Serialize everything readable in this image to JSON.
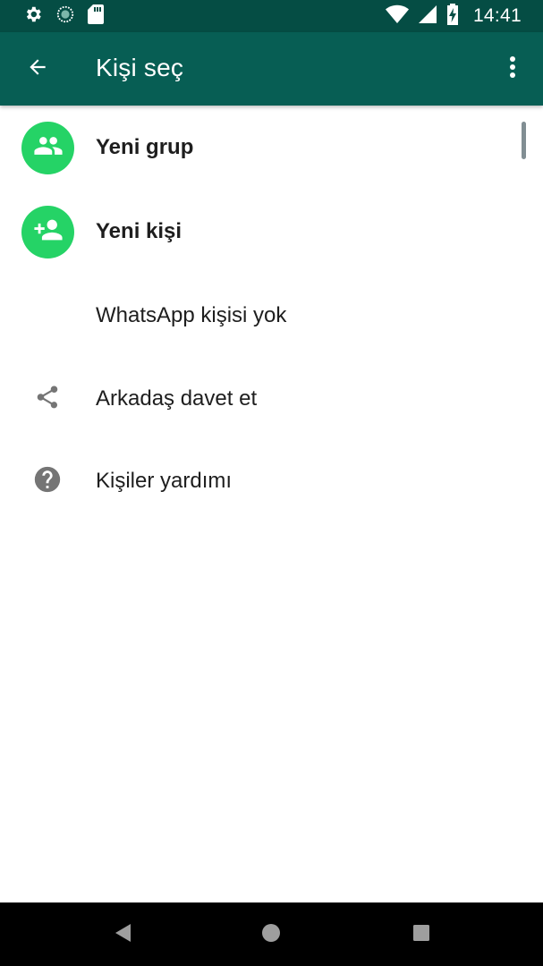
{
  "status_bar": {
    "time": "14:41",
    "left_icons": [
      "settings-icon",
      "sync-icon",
      "sd-card-icon"
    ],
    "right_icons": [
      "wifi-icon",
      "cell-signal-icon",
      "battery-charging-icon"
    ]
  },
  "app_bar": {
    "title": "Kişi seç",
    "back_icon": "arrow-back-icon",
    "menu_icon": "more-vert-icon",
    "background": "#075e54",
    "status_background": "#054d44"
  },
  "list": {
    "items": [
      {
        "label": "Yeni grup",
        "icon": "group-icon",
        "style": "avatar"
      },
      {
        "label": "Yeni kişi",
        "icon": "person-add-icon",
        "style": "avatar"
      },
      {
        "label": "WhatsApp kişisi yok",
        "icon": "",
        "style": "none"
      },
      {
        "label": "Arkadaş davet et",
        "icon": "share-icon",
        "style": "plain"
      },
      {
        "label": "Kişiler yardımı",
        "icon": "help-icon",
        "style": "plain"
      }
    ],
    "accent": "#25d366"
  },
  "nav_bar": {
    "buttons": [
      "back-triangle-icon",
      "home-circle-icon",
      "recents-square-icon"
    ]
  }
}
